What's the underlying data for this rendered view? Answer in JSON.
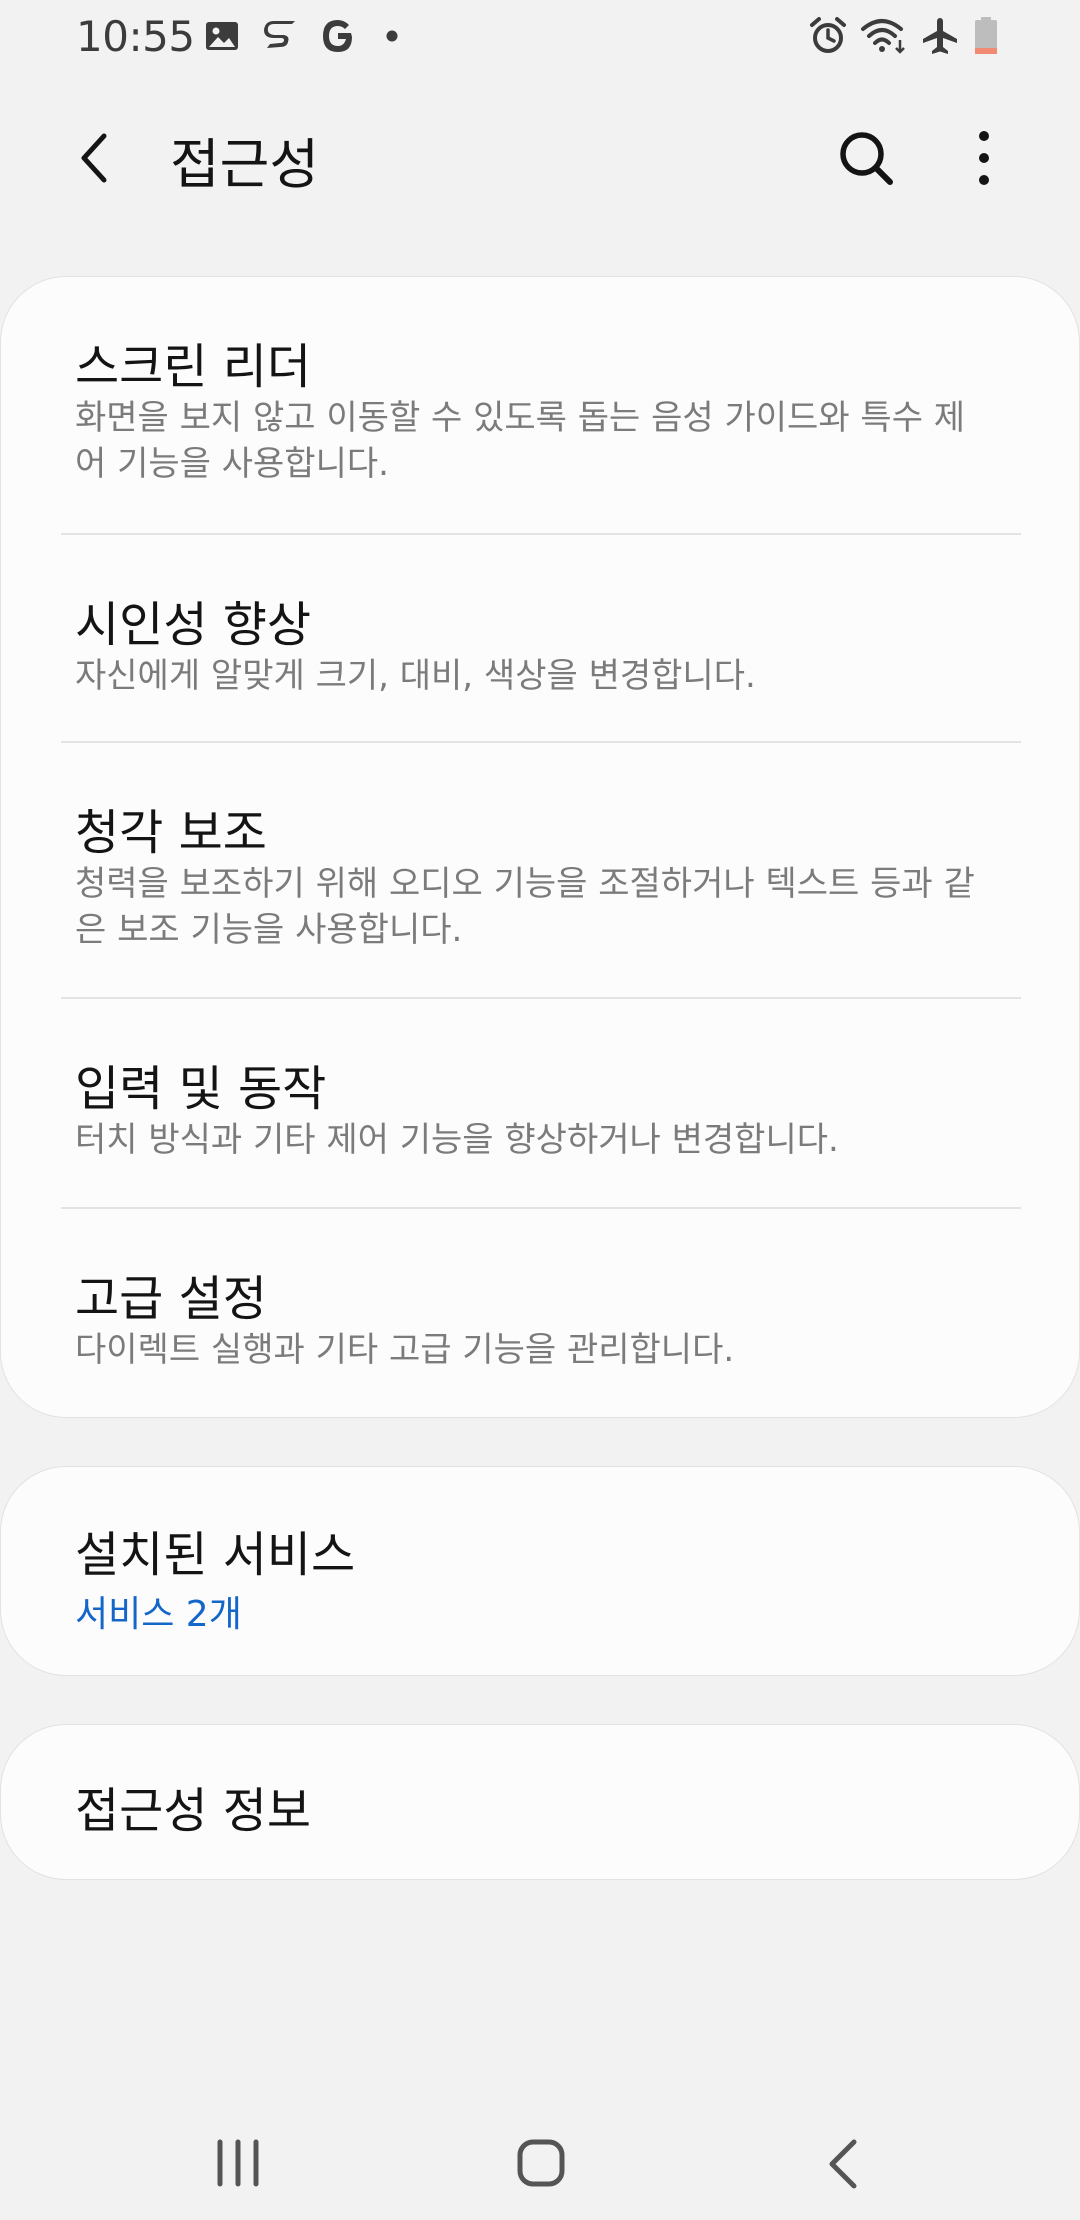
{
  "status_bar": {
    "time": "10:55",
    "left_icons": [
      "gallery-icon",
      "s-app-icon",
      "google-icon",
      "dot-icon"
    ],
    "right_icons": [
      "alarm-icon",
      "wifi-icon",
      "airplane-icon",
      "battery-icon"
    ],
    "battery_color": "#f08a72"
  },
  "app_bar": {
    "title": "접근성"
  },
  "main_items": [
    {
      "title": "스크린 리더",
      "summary": "화면을 보지 않고 이동할 수 있도록 돕는 음성 가이드와 특수 제어 기능을 사용합니다."
    },
    {
      "title": "시인성 향상",
      "summary": "자신에게 알맞게 크기, 대비, 색상을 변경합니다."
    },
    {
      "title": "청각 보조",
      "summary": "청력을 보조하기 위해 오디오 기능을 조절하거나 텍스트 등과 같은 보조 기능을 사용합니다."
    },
    {
      "title": "입력 및 동작",
      "summary": "터치 방식과 기타 제어 기능을 향상하거나 변경합니다."
    },
    {
      "title": "고급 설정",
      "summary": "다이렉트 실행과 기타 고급 기능을 관리합니다."
    }
  ],
  "services": {
    "title": "설치된 서비스",
    "count": "서비스 2개"
  },
  "info": {
    "title": "접근성 정보"
  },
  "colors": {
    "background": "#f2f2f2",
    "card": "#fcfcfc",
    "accent": "#1466c8",
    "summary_text": "#7b7b7b"
  }
}
